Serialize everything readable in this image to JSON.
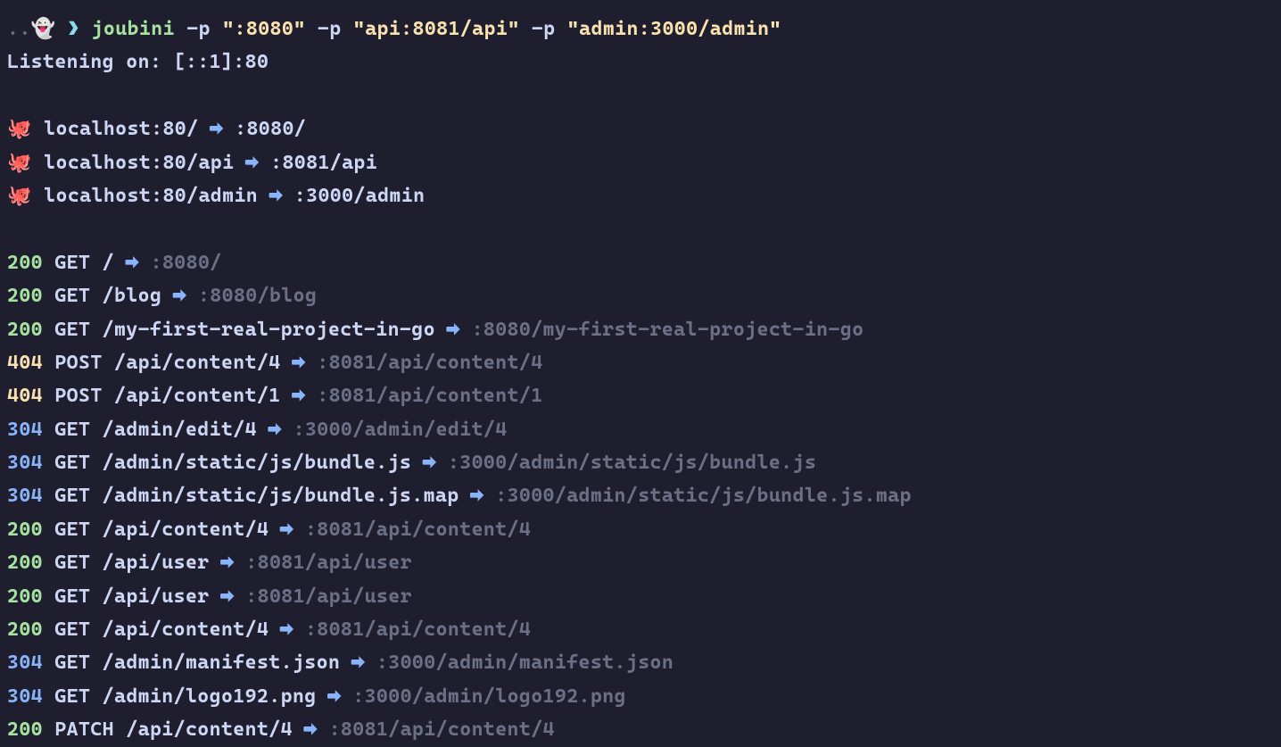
{
  "prompt": {
    "prefix": "..",
    "ghost": "👻",
    "symbol": "❯",
    "cmd_name": "joubini",
    "flag": "-p",
    "arg1": "\":8080\"",
    "arg2": "\"api:8081/api\"",
    "arg3": "\"admin:3000/admin\""
  },
  "listening": "Listening on: [::1]:80",
  "icons": {
    "octopus": "🐙",
    "arrow": "➡"
  },
  "routes": [
    {
      "src": "localhost:80/",
      "dst": ":8080/"
    },
    {
      "src": "localhost:80/api",
      "dst": ":8081/api"
    },
    {
      "src": "localhost:80/admin",
      "dst": ":3000/admin"
    }
  ],
  "requests": [
    {
      "status": "200",
      "method": "GET",
      "path": "/",
      "dst": ":8080/"
    },
    {
      "status": "200",
      "method": "GET",
      "path": "/blog",
      "dst": ":8080/blog"
    },
    {
      "status": "200",
      "method": "GET",
      "path": "/my-first-real-project-in-go",
      "dst": ":8080/my-first-real-project-in-go"
    },
    {
      "status": "404",
      "method": "POST",
      "path": "/api/content/4",
      "dst": ":8081/api/content/4"
    },
    {
      "status": "404",
      "method": "POST",
      "path": "/api/content/1",
      "dst": ":8081/api/content/1"
    },
    {
      "status": "304",
      "method": "GET",
      "path": "/admin/edit/4",
      "dst": ":3000/admin/edit/4"
    },
    {
      "status": "304",
      "method": "GET",
      "path": "/admin/static/js/bundle.js",
      "dst": ":3000/admin/static/js/bundle.js"
    },
    {
      "status": "304",
      "method": "GET",
      "path": "/admin/static/js/bundle.js.map",
      "dst": ":3000/admin/static/js/bundle.js.map"
    },
    {
      "status": "200",
      "method": "GET",
      "path": "/api/content/4",
      "dst": ":8081/api/content/4"
    },
    {
      "status": "200",
      "method": "GET",
      "path": "/api/user",
      "dst": ":8081/api/user"
    },
    {
      "status": "200",
      "method": "GET",
      "path": "/api/user",
      "dst": ":8081/api/user"
    },
    {
      "status": "200",
      "method": "GET",
      "path": "/api/content/4",
      "dst": ":8081/api/content/4"
    },
    {
      "status": "304",
      "method": "GET",
      "path": "/admin/manifest.json",
      "dst": ":3000/admin/manifest.json"
    },
    {
      "status": "304",
      "method": "GET",
      "path": "/admin/logo192.png",
      "dst": ":3000/admin/logo192.png"
    },
    {
      "status": "200",
      "method": "PATCH",
      "path": "/api/content/4",
      "dst": ":8081/api/content/4"
    }
  ]
}
